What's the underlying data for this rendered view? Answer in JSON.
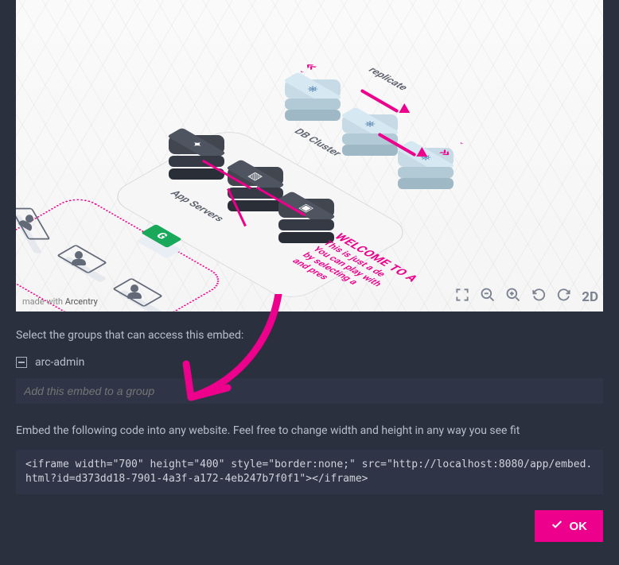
{
  "preview": {
    "watermark_prefix": "made with ",
    "watermark_brand": "Arcentry",
    "labels": {
      "replicate": "replicate",
      "db_cluster": "DB Cluster",
      "app_servers": "App Servers"
    },
    "welcome": {
      "l1": "WELCOME TO A",
      "l2": "This is just a de",
      "l3": "You can play with",
      "l4": "by selecting a",
      "l5": "and pres"
    },
    "toolbar": {
      "d2_label": "2D"
    },
    "green_cube_glyph": "G"
  },
  "select_groups_label": "Select the groups that can access this embed:",
  "groups": [
    {
      "name": "arc-admin"
    }
  ],
  "group_input_placeholder": "Add this embed to a group",
  "embed_label": "Embed the following code into any website. Feel free to change width and height in any way you see fit",
  "embed_code": "<iframe width=\"700\" height=\"400\" style=\"border:none;\" src=\"http://localhost:8080/app/embed.html?id=d373dd18-7901-4a3f-a172-4eb247b7f0f1\"></iframe>",
  "ok_label": "OK"
}
